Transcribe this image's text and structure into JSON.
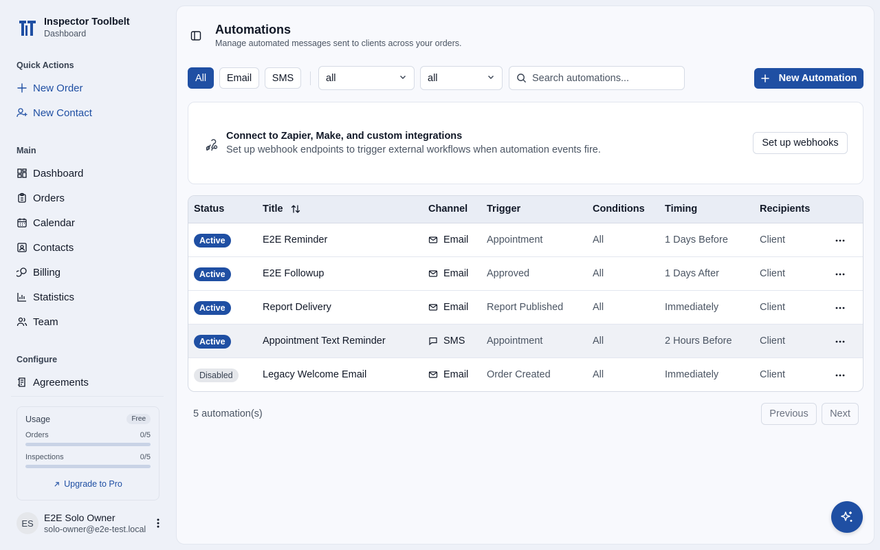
{
  "brand": {
    "title": "Inspector Toolbelt",
    "subtitle": "Dashboard",
    "logo_icon": "inspector-toolbelt-logo"
  },
  "sidebar": {
    "quick_actions_label": "Quick Actions",
    "quick_actions": [
      {
        "label": "New Order",
        "icon": "plus-icon"
      },
      {
        "label": "New Contact",
        "icon": "user-plus-icon"
      }
    ],
    "main_label": "Main",
    "main_items": [
      {
        "label": "Dashboard",
        "icon": "dashboard-icon"
      },
      {
        "label": "Orders",
        "icon": "clipboard-icon"
      },
      {
        "label": "Calendar",
        "icon": "calendar-icon"
      },
      {
        "label": "Contacts",
        "icon": "contact-card-icon"
      },
      {
        "label": "Billing",
        "icon": "billing-icon"
      },
      {
        "label": "Statistics",
        "icon": "bar-chart-icon"
      },
      {
        "label": "Team",
        "icon": "users-icon"
      }
    ],
    "configure_label": "Configure",
    "configure_items": [
      {
        "label": "Agreements",
        "icon": "agreement-icon"
      }
    ],
    "usage": {
      "title": "Usage",
      "plan": "Free",
      "rows": [
        {
          "label": "Orders",
          "value": "0/5",
          "fill": 0.0
        },
        {
          "label": "Inspections",
          "value": "0/5",
          "fill": 0.0
        }
      ],
      "upgrade_label": "Upgrade to Pro"
    },
    "user": {
      "initials": "ES",
      "name": "E2E Solo Owner",
      "email": "solo-owner@e2e-test.local"
    }
  },
  "header": {
    "title": "Automations",
    "subtitle": "Manage automated messages sent to clients across your orders."
  },
  "filters": {
    "tabs": [
      "All",
      "Email",
      "SMS"
    ],
    "active_tab": "All",
    "select_1": "all",
    "select_2": "all",
    "search_placeholder": "Search automations...",
    "new_button": "New Automation"
  },
  "webhook": {
    "title": "Connect to Zapier, Make, and custom integrations",
    "description": "Set up webhook endpoints to trigger external workflows when automation events fire.",
    "button": "Set up webhooks"
  },
  "table": {
    "columns": [
      "Status",
      "Title",
      "Channel",
      "Trigger",
      "Conditions",
      "Timing",
      "Recipients"
    ],
    "rows": [
      {
        "status": "Active",
        "title": "E2E Reminder",
        "channel": "Email",
        "trigger": "Appointment",
        "conditions": "All",
        "timing": "1 Days Before",
        "recipients": "Client"
      },
      {
        "status": "Active",
        "title": "E2E Followup",
        "channel": "Email",
        "trigger": "Approved",
        "conditions": "All",
        "timing": "1 Days After",
        "recipients": "Client"
      },
      {
        "status": "Active",
        "title": "Report Delivery",
        "channel": "Email",
        "trigger": "Report Published",
        "conditions": "All",
        "timing": "Immediately",
        "recipients": "Client"
      },
      {
        "status": "Active",
        "title": "Appointment Text Reminder",
        "channel": "SMS",
        "trigger": "Appointment",
        "conditions": "All",
        "timing": "2 Hours Before",
        "recipients": "Client"
      },
      {
        "status": "Disabled",
        "title": "Legacy Welcome Email",
        "channel": "Email",
        "trigger": "Order Created",
        "conditions": "All",
        "timing": "Immediately",
        "recipients": "Client"
      }
    ]
  },
  "footer": {
    "count": "5 automation(s)",
    "previous": "Previous",
    "next": "Next"
  },
  "colors": {
    "accent": "#1f4fa3",
    "background": "#eef1f8",
    "panel": "#f8f9fd"
  }
}
